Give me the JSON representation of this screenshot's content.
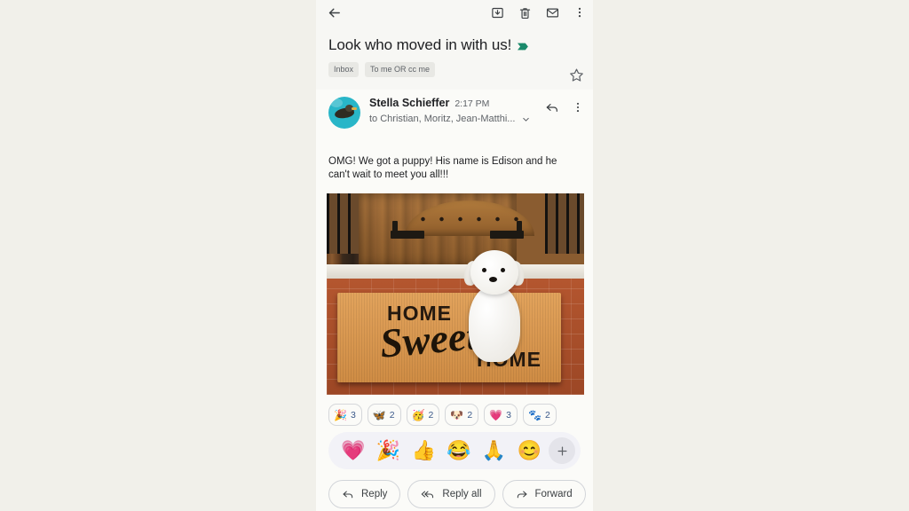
{
  "colors": {
    "page_background": "#f1f0ea",
    "phone_background": "#fbfbf8",
    "header_background": "#f7f7f4",
    "important_marker": "#1b8a6b",
    "count_text": "#3c5a8a",
    "avatar_background": "#29b6c8",
    "picker_background": "#f2f2f7"
  },
  "topbar": {
    "back_label": "Back",
    "archive_label": "Archive",
    "delete_label": "Delete",
    "unread_label": "Mark as unread",
    "more_label": "More options"
  },
  "subject": {
    "text": "Look who moved in with us!",
    "important_marker_label": "Important",
    "star_label": "Star",
    "labels": [
      "Inbox",
      "To me OR cc me"
    ]
  },
  "message": {
    "sender_name": "Stella Schieffer",
    "time": "2:17 PM",
    "recipients": "to Christian, Moritz, Jean-Matthi...",
    "expand_label": "Show details",
    "reply_icon_label": "Reply",
    "more_icon_label": "More options",
    "avatar_label": "Sender avatar"
  },
  "body": {
    "text": "OMG! We got a puppy! His name is Edison and he can't wait to meet you all!!!"
  },
  "photo": {
    "alt": "White Maltese puppy sitting on a HOME SWEET HOME doormat in front of wooden doors",
    "mat_top": "HOME",
    "mat_script": "Sweet",
    "mat_bottom": "HOME"
  },
  "reactions": {
    "chips": [
      {
        "emoji": "🎉",
        "count": "3",
        "name": "party-popper"
      },
      {
        "emoji": "🦋",
        "count": "2",
        "name": "butterfly"
      },
      {
        "emoji": "🥳",
        "count": "2",
        "name": "partying-face"
      },
      {
        "emoji": "🐶",
        "count": "2",
        "name": "dog-face"
      },
      {
        "emoji": "💗",
        "count": "3",
        "name": "growing-heart"
      },
      {
        "emoji": "🐾",
        "count": "2",
        "name": "paw-prints"
      }
    ],
    "picker": [
      {
        "emoji": "💗",
        "name": "growing-heart"
      },
      {
        "emoji": "🎉",
        "name": "party-popper"
      },
      {
        "emoji": "👍",
        "name": "thumbs-up"
      },
      {
        "emoji": "😂",
        "name": "face-with-tears-of-joy"
      },
      {
        "emoji": "🙏",
        "name": "folded-hands"
      },
      {
        "emoji": "😊",
        "name": "smiling-face"
      }
    ],
    "add_label": "+"
  },
  "footer": {
    "reply": "Reply",
    "reply_all": "Reply all",
    "forward": "Forward",
    "emoji_label": "Add reaction"
  }
}
